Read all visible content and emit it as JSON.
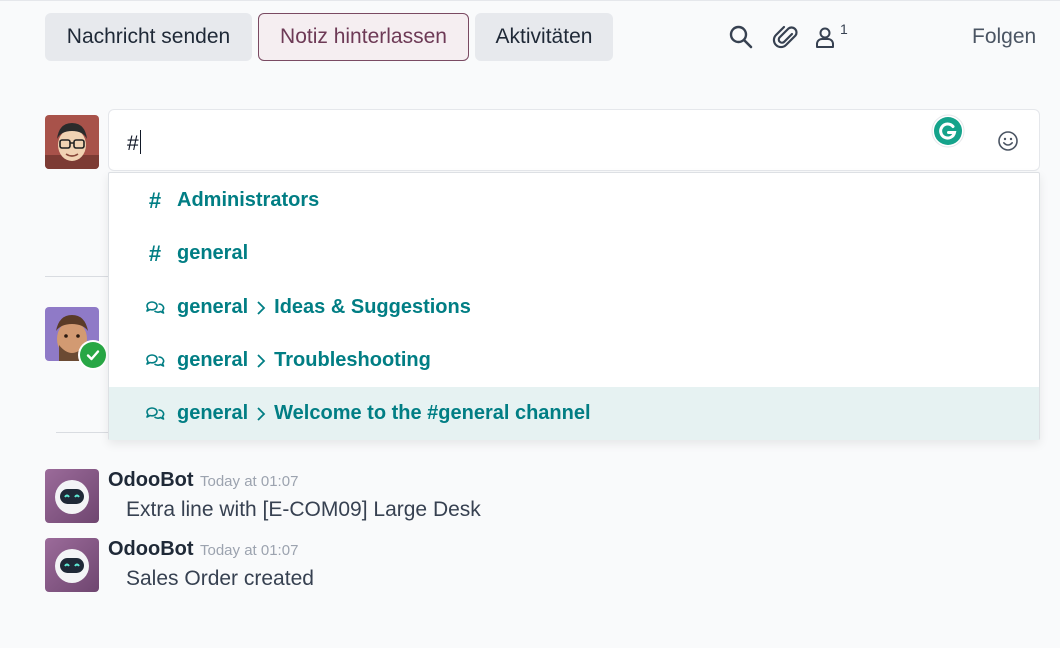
{
  "toolbar": {
    "send_message_label": "Nachricht senden",
    "log_note_label": "Notiz hinterlassen",
    "activities_label": "Aktivitäten",
    "follower_count": "1",
    "follow_label": "Folgen"
  },
  "composer": {
    "value": "#"
  },
  "suggestions": [
    {
      "type": "channel",
      "icon": "hash-icon",
      "name": "Administrators",
      "sub": ""
    },
    {
      "type": "channel",
      "icon": "hash-icon",
      "name": "general",
      "sub": ""
    },
    {
      "type": "thread",
      "icon": "thread-icon",
      "name": "general",
      "sub": "Ideas & Suggestions"
    },
    {
      "type": "thread",
      "icon": "thread-icon",
      "name": "general",
      "sub": "Troubleshooting"
    },
    {
      "type": "thread",
      "icon": "thread-icon",
      "name": "general",
      "sub": "Welcome to the #general channel",
      "active": true
    }
  ],
  "messages": [
    {
      "author": "OdooBot",
      "time": "Today at 01:07",
      "body": "Extra line with [E-COM09] Large Desk"
    },
    {
      "author": "OdooBot",
      "time": "Today at 01:07",
      "body": "Sales Order created"
    }
  ],
  "colors": {
    "accent_teal": "#017e84",
    "note_border": "#7a4a62",
    "online_green": "#28a745"
  }
}
